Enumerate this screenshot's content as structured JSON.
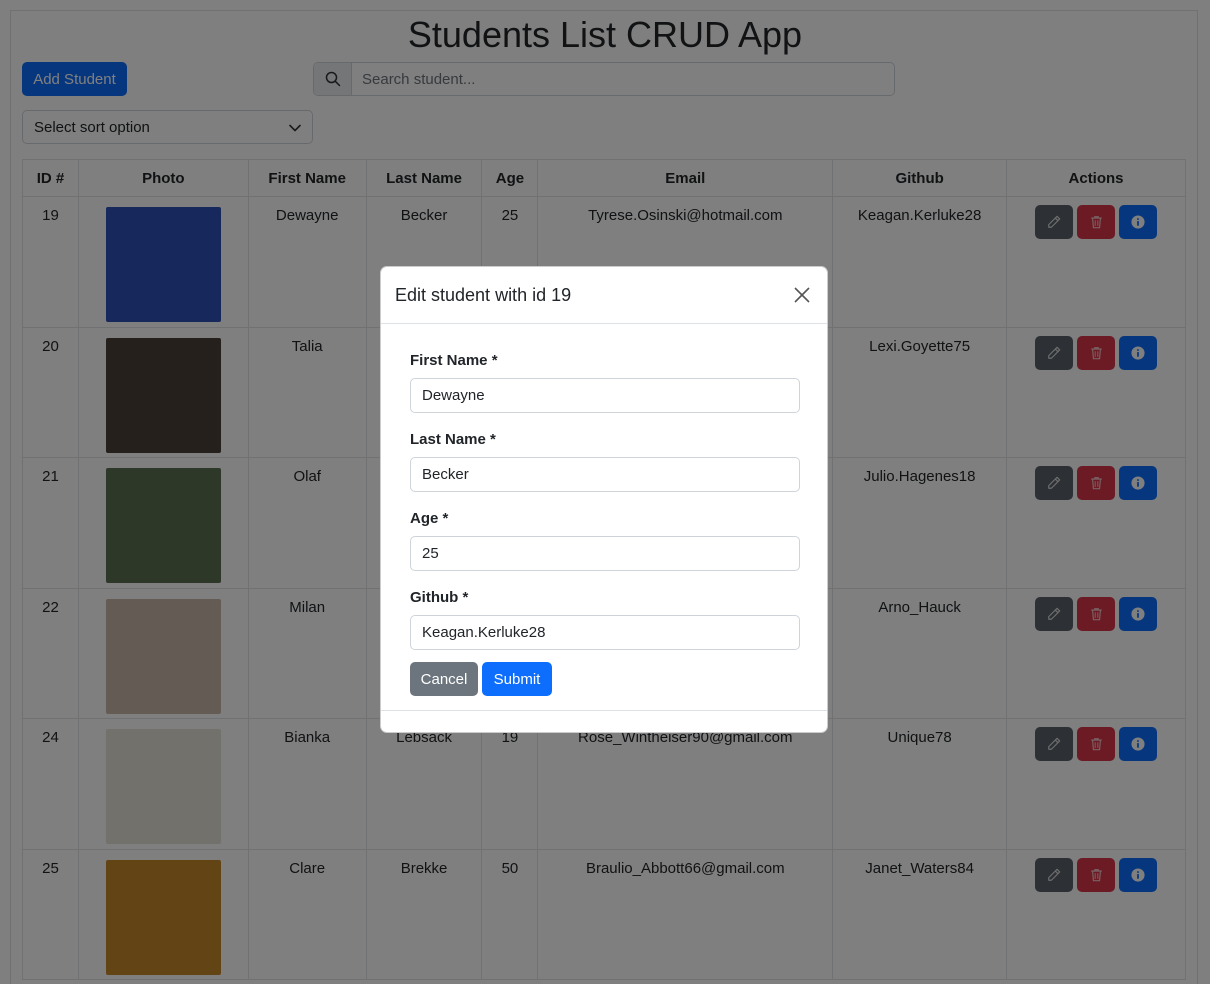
{
  "app": {
    "title": "Students List CRUD App",
    "add_button": "Add Student",
    "search_placeholder": "Search student...",
    "sort_placeholder": "Select sort option"
  },
  "table": {
    "headers": [
      "ID #",
      "Photo",
      "First Name",
      "Last Name",
      "Age",
      "Email",
      "Github",
      "Actions"
    ],
    "rows": [
      {
        "id": "19",
        "first": "Dewayne",
        "last": "Becker",
        "age": "25",
        "email": "Tyrese.Osinski@hotmail.com",
        "github": "Keagan.Kerluke28",
        "photo_color": "#2e50b8"
      },
      {
        "id": "20",
        "first": "Talia",
        "last": "",
        "age": "",
        "email": "",
        "github": "Lexi.Goyette75",
        "photo_color": "#4a4038"
      },
      {
        "id": "21",
        "first": "Olaf",
        "last": "",
        "age": "",
        "email": "",
        "github": "Julio.Hagenes18",
        "photo_color": "#5c7050"
      },
      {
        "id": "22",
        "first": "Milan",
        "last": "",
        "age": "",
        "email": "",
        "github": "Arno_Hauck",
        "photo_color": "#c9b8a8"
      },
      {
        "id": "24",
        "first": "Bianka",
        "last": "Lebsack",
        "age": "19",
        "email": "Rose_Wintheiser90@gmail.com",
        "github": "Unique78",
        "photo_color": "#e7e2d8"
      },
      {
        "id": "25",
        "first": "Clare",
        "last": "Brekke",
        "age": "50",
        "email": "Braulio_Abbott66@gmail.com",
        "github": "Janet_Waters84",
        "photo_color": "#c78a2a"
      }
    ]
  },
  "modal": {
    "title": "Edit student with id 19",
    "fields": [
      {
        "label": "First Name *",
        "value": "Dewayne"
      },
      {
        "label": "Last Name *",
        "value": "Becker"
      },
      {
        "label": "Age *",
        "value": "25"
      },
      {
        "label": "Github *",
        "value": "Keagan.Kerluke28"
      }
    ],
    "cancel": "Cancel",
    "submit": "Submit"
  },
  "icons": {
    "search": "search-icon",
    "chevron": "chevron-down-icon",
    "edit": "pencil-icon",
    "delete": "trash-icon",
    "info": "info-icon",
    "close": "close-icon"
  },
  "colors": {
    "primary": "#0d6efd",
    "secondary": "#6c757d",
    "danger": "#dc3545"
  }
}
